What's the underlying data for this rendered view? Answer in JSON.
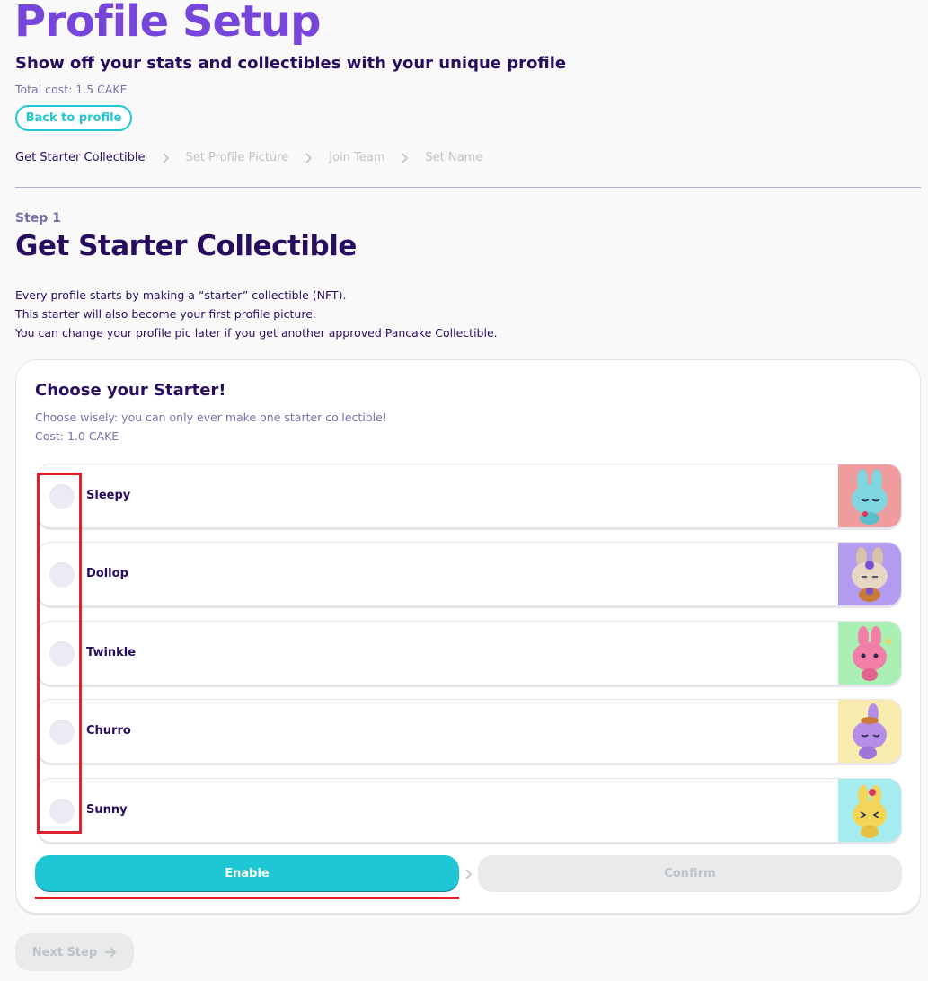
{
  "header": {
    "title": "Profile Setup",
    "subtitle": "Show off your stats and collectibles with your unique profile",
    "total_cost": "Total cost: 1.5 CAKE",
    "back_button": "Back to profile"
  },
  "breadcrumb": [
    {
      "label": "Get Starter Collectible",
      "active": true
    },
    {
      "label": "Set Profile Picture",
      "active": false
    },
    {
      "label": "Join Team",
      "active": false
    },
    {
      "label": "Set Name",
      "active": false
    }
  ],
  "step": {
    "label": "Step 1",
    "title": "Get Starter Collectible",
    "intro_lines": [
      "Every profile starts by making a “starter” collectible (NFT).",
      "This starter will also become your first profile picture.",
      "You can change your profile pic later if you get another approved Pancake Collectible."
    ]
  },
  "card": {
    "title": "Choose your Starter!",
    "desc": "Choose wisely: you can only ever make one starter collectible!",
    "cost": "Cost: 1.0 CAKE"
  },
  "options": [
    {
      "label": "Sleepy",
      "bg": "#ee9c9e",
      "body": "#7fd6e0",
      "icon": "sleepy-bunny-icon"
    },
    {
      "label": "Dollop",
      "bg": "#b39bf0",
      "body": "#d8c2a8",
      "icon": "dollop-bunny-icon"
    },
    {
      "label": "Twinkle",
      "bg": "#aaf0b4",
      "body": "#f27fa8",
      "icon": "twinkle-bunny-icon"
    },
    {
      "label": "Churro",
      "bg": "#f8ecae",
      "body": "#b58ee8",
      "icon": "churro-bunny-icon"
    },
    {
      "label": "Sunny",
      "bg": "#a5ecef",
      "body": "#f3d55a",
      "icon": "sunny-bunny-icon"
    }
  ],
  "actions": {
    "enable": "Enable",
    "confirm": "Confirm",
    "next_step": "Next Step"
  },
  "colors": {
    "primary": "#1fc7d4",
    "secondary": "#7645d9",
    "text": "#280d5f",
    "text_subtle": "#7a6eaa",
    "disabled": "#bdc2c4",
    "highlight": "#e0202a"
  }
}
